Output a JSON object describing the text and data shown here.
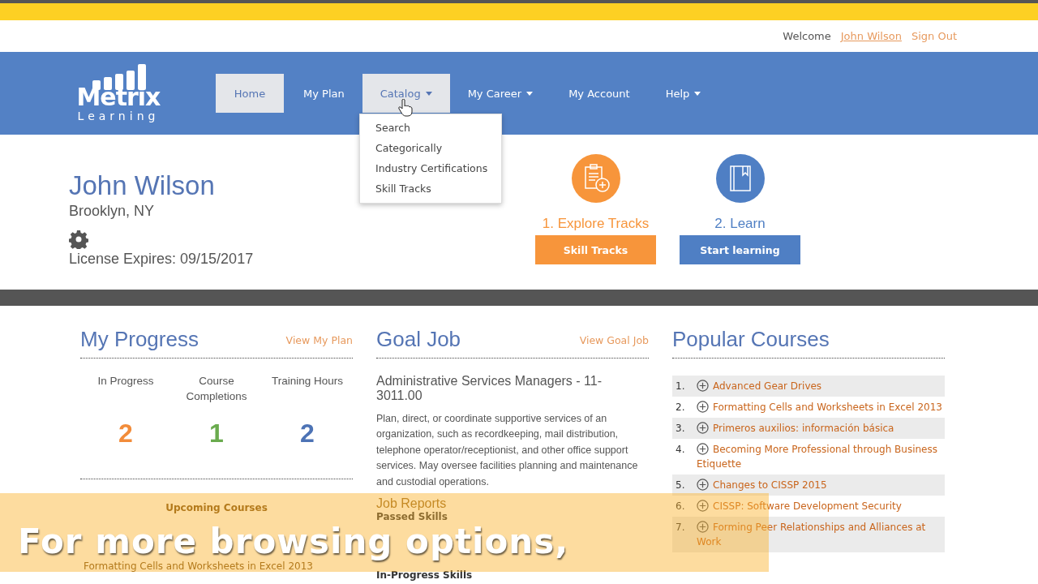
{
  "header": {
    "welcome": "Welcome",
    "user_link": "John Wilson",
    "sign_out": "Sign Out"
  },
  "logo": {
    "name": "Metrix",
    "sub": "Learning"
  },
  "nav": [
    {
      "label": "Home",
      "selected": true,
      "dropdown": false
    },
    {
      "label": "My Plan",
      "selected": false,
      "dropdown": false
    },
    {
      "label": "Catalog",
      "selected": true,
      "dropdown": true,
      "menu": [
        "Search",
        "Categorically",
        "Industry Certifications",
        "Skill Tracks"
      ]
    },
    {
      "label": "My Career",
      "selected": false,
      "dropdown": true
    },
    {
      "label": "My Account",
      "selected": false,
      "dropdown": false
    },
    {
      "label": "Help",
      "selected": false,
      "dropdown": true
    }
  ],
  "profile": {
    "name": "John Wilson",
    "location": "Brooklyn, NY",
    "license": "License Expires: 09/15/2017"
  },
  "steps": [
    {
      "kind": "explore",
      "title": "1. Explore Tracks",
      "button": "Skill Tracks",
      "color": "#f7953b"
    },
    {
      "kind": "learn",
      "title": "2. Learn",
      "button": "Start learning",
      "color": "#4f7fc4"
    }
  ],
  "my_progress": {
    "title": "My Progress",
    "link": "View My Plan",
    "stats": [
      {
        "label": "In Progress",
        "value": "2",
        "color": "#f28c3a"
      },
      {
        "label": "Course Completions",
        "value": "1",
        "color": "#6aab4e"
      },
      {
        "label": "Training Hours",
        "value": "2",
        "color": "#4d73b5"
      }
    ],
    "upcoming_title": "Upcoming Courses",
    "upcoming": [
      "Formatting Cells and Worksheets in Excel 2013"
    ]
  },
  "goal_job": {
    "title": "Goal Job",
    "link": "View Goal Job",
    "job": "Administrative Services Managers - 11-3011.00",
    "description": "Plan, direct, or coordinate supportive services of an organization, such as recordkeeping, mail distribution, telephone operator/receptionist, and other office support services. May oversee facilities planning and maintenance and custodial operations.",
    "reports_title": "Job Reports",
    "sections": [
      "Passed Skills",
      "In-Progress Skills"
    ]
  },
  "popular_courses": {
    "title": "Popular Courses",
    "items": [
      {
        "number": "1.",
        "title": "Advanced Gear Drives"
      },
      {
        "number": "2.",
        "title": "Formatting Cells and Worksheets in Excel 2013"
      },
      {
        "number": "3.",
        "title": "Primeros auxilios: información básica"
      },
      {
        "number": "4.",
        "title": "Becoming More Professional through Business Etiquette"
      },
      {
        "number": "5.",
        "title": "Changes to CISSP 2015"
      },
      {
        "number": "6.",
        "title": "CISSP: Software Development Security"
      },
      {
        "number": "7.",
        "title": "Forming Peer Relationships and Alliances at Work"
      }
    ]
  },
  "caption": "For more browsing options,"
}
